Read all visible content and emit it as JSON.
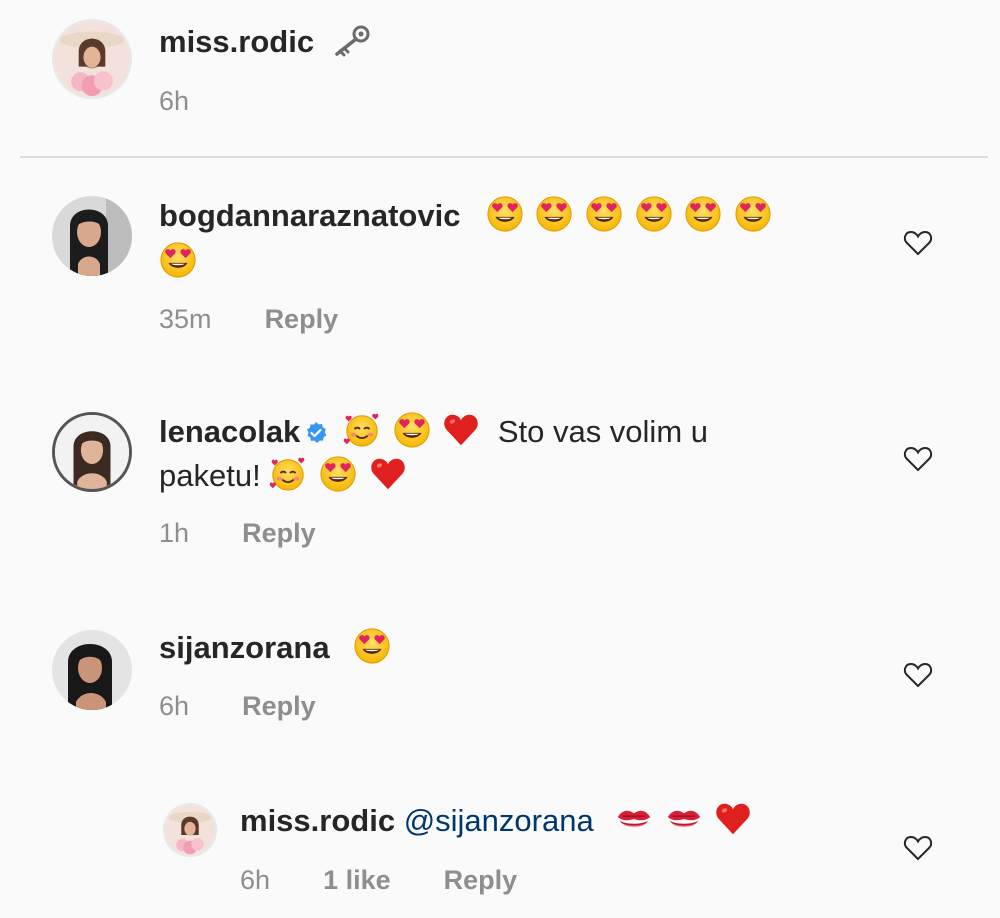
{
  "caption": {
    "username": "miss.rodic",
    "icon": "key-icon",
    "time": "6h"
  },
  "comments": [
    {
      "username": "bogdannaraznatovic",
      "emojis": [
        "heart-eyes",
        "heart-eyes",
        "heart-eyes",
        "heart-eyes",
        "heart-eyes",
        "heart-eyes",
        "heart-eyes"
      ],
      "time": "35m",
      "reply_label": "Reply"
    },
    {
      "username": "lenacolak",
      "verified": true,
      "text_line1": "Sto vas volim u",
      "text_line2": "paketu!",
      "time": "1h",
      "reply_label": "Reply"
    },
    {
      "username": "sijanzorana",
      "time": "6h",
      "reply_label": "Reply"
    }
  ],
  "reply": {
    "username": "miss.rodic",
    "mention": "@sijanzorana",
    "time": "6h",
    "likes": "1 like",
    "reply_label": "Reply"
  },
  "colors": {
    "background": "#fafafa",
    "text": "#262626",
    "meta": "#8e8e8e",
    "mention": "#00376b",
    "verified": "#3897f0"
  }
}
